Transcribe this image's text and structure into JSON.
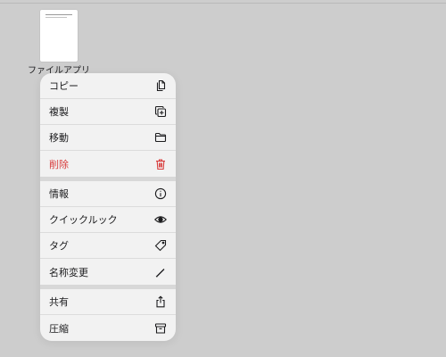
{
  "file": {
    "name": "ファイルアプリ"
  },
  "menu": {
    "group1": [
      {
        "label": "コピー",
        "icon": "copy-icon"
      },
      {
        "label": "複製",
        "icon": "duplicate-icon"
      },
      {
        "label": "移動",
        "icon": "folder-icon"
      },
      {
        "label": "削除",
        "icon": "trash-icon",
        "destructive": true
      }
    ],
    "group2": [
      {
        "label": "情報",
        "icon": "info-icon"
      },
      {
        "label": "クイックルック",
        "icon": "eye-icon"
      },
      {
        "label": "タグ",
        "icon": "tag-icon"
      },
      {
        "label": "名称変更",
        "icon": "pencil-icon"
      }
    ],
    "group3": [
      {
        "label": "共有",
        "icon": "share-icon"
      },
      {
        "label": "圧縮",
        "icon": "archive-icon"
      }
    ]
  },
  "colors": {
    "background": "#cdcdcd",
    "menu_bg": "#f2f2f2",
    "destructive": "#d83b3b"
  }
}
